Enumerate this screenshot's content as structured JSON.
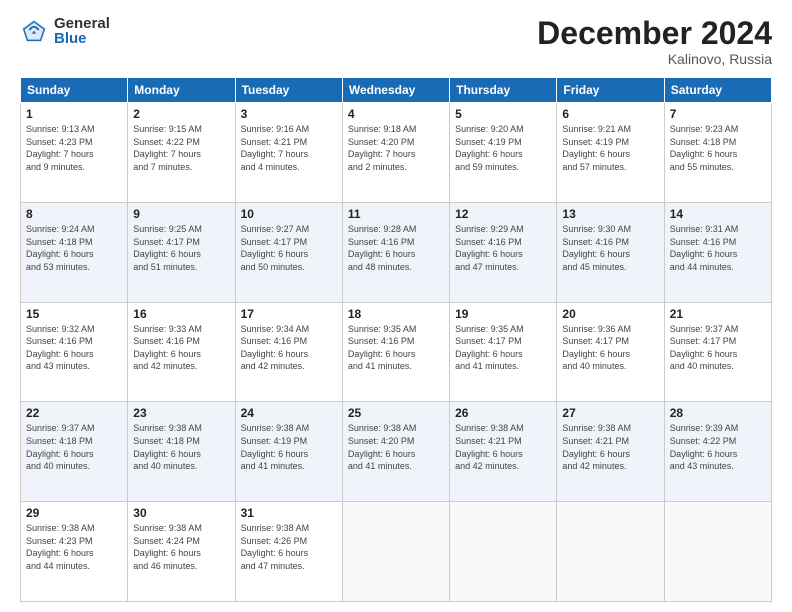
{
  "logo": {
    "general": "General",
    "blue": "Blue"
  },
  "title": "December 2024",
  "location": "Kalinovo, Russia",
  "days_of_week": [
    "Sunday",
    "Monday",
    "Tuesday",
    "Wednesday",
    "Thursday",
    "Friday",
    "Saturday"
  ],
  "weeks": [
    [
      {
        "day": 1,
        "info": "Sunrise: 9:13 AM\nSunset: 4:23 PM\nDaylight: 7 hours\nand 9 minutes."
      },
      {
        "day": 2,
        "info": "Sunrise: 9:15 AM\nSunset: 4:22 PM\nDaylight: 7 hours\nand 7 minutes."
      },
      {
        "day": 3,
        "info": "Sunrise: 9:16 AM\nSunset: 4:21 PM\nDaylight: 7 hours\nand 4 minutes."
      },
      {
        "day": 4,
        "info": "Sunrise: 9:18 AM\nSunset: 4:20 PM\nDaylight: 7 hours\nand 2 minutes."
      },
      {
        "day": 5,
        "info": "Sunrise: 9:20 AM\nSunset: 4:19 PM\nDaylight: 6 hours\nand 59 minutes."
      },
      {
        "day": 6,
        "info": "Sunrise: 9:21 AM\nSunset: 4:19 PM\nDaylight: 6 hours\nand 57 minutes."
      },
      {
        "day": 7,
        "info": "Sunrise: 9:23 AM\nSunset: 4:18 PM\nDaylight: 6 hours\nand 55 minutes."
      }
    ],
    [
      {
        "day": 8,
        "info": "Sunrise: 9:24 AM\nSunset: 4:18 PM\nDaylight: 6 hours\nand 53 minutes."
      },
      {
        "day": 9,
        "info": "Sunrise: 9:25 AM\nSunset: 4:17 PM\nDaylight: 6 hours\nand 51 minutes."
      },
      {
        "day": 10,
        "info": "Sunrise: 9:27 AM\nSunset: 4:17 PM\nDaylight: 6 hours\nand 50 minutes."
      },
      {
        "day": 11,
        "info": "Sunrise: 9:28 AM\nSunset: 4:16 PM\nDaylight: 6 hours\nand 48 minutes."
      },
      {
        "day": 12,
        "info": "Sunrise: 9:29 AM\nSunset: 4:16 PM\nDaylight: 6 hours\nand 47 minutes."
      },
      {
        "day": 13,
        "info": "Sunrise: 9:30 AM\nSunset: 4:16 PM\nDaylight: 6 hours\nand 45 minutes."
      },
      {
        "day": 14,
        "info": "Sunrise: 9:31 AM\nSunset: 4:16 PM\nDaylight: 6 hours\nand 44 minutes."
      }
    ],
    [
      {
        "day": 15,
        "info": "Sunrise: 9:32 AM\nSunset: 4:16 PM\nDaylight: 6 hours\nand 43 minutes."
      },
      {
        "day": 16,
        "info": "Sunrise: 9:33 AM\nSunset: 4:16 PM\nDaylight: 6 hours\nand 42 minutes."
      },
      {
        "day": 17,
        "info": "Sunrise: 9:34 AM\nSunset: 4:16 PM\nDaylight: 6 hours\nand 42 minutes."
      },
      {
        "day": 18,
        "info": "Sunrise: 9:35 AM\nSunset: 4:16 PM\nDaylight: 6 hours\nand 41 minutes."
      },
      {
        "day": 19,
        "info": "Sunrise: 9:35 AM\nSunset: 4:17 PM\nDaylight: 6 hours\nand 41 minutes."
      },
      {
        "day": 20,
        "info": "Sunrise: 9:36 AM\nSunset: 4:17 PM\nDaylight: 6 hours\nand 40 minutes."
      },
      {
        "day": 21,
        "info": "Sunrise: 9:37 AM\nSunset: 4:17 PM\nDaylight: 6 hours\nand 40 minutes."
      }
    ],
    [
      {
        "day": 22,
        "info": "Sunrise: 9:37 AM\nSunset: 4:18 PM\nDaylight: 6 hours\nand 40 minutes."
      },
      {
        "day": 23,
        "info": "Sunrise: 9:38 AM\nSunset: 4:18 PM\nDaylight: 6 hours\nand 40 minutes."
      },
      {
        "day": 24,
        "info": "Sunrise: 9:38 AM\nSunset: 4:19 PM\nDaylight: 6 hours\nand 41 minutes."
      },
      {
        "day": 25,
        "info": "Sunrise: 9:38 AM\nSunset: 4:20 PM\nDaylight: 6 hours\nand 41 minutes."
      },
      {
        "day": 26,
        "info": "Sunrise: 9:38 AM\nSunset: 4:21 PM\nDaylight: 6 hours\nand 42 minutes."
      },
      {
        "day": 27,
        "info": "Sunrise: 9:38 AM\nSunset: 4:21 PM\nDaylight: 6 hours\nand 42 minutes."
      },
      {
        "day": 28,
        "info": "Sunrise: 9:39 AM\nSunset: 4:22 PM\nDaylight: 6 hours\nand 43 minutes."
      }
    ],
    [
      {
        "day": 29,
        "info": "Sunrise: 9:38 AM\nSunset: 4:23 PM\nDaylight: 6 hours\nand 44 minutes."
      },
      {
        "day": 30,
        "info": "Sunrise: 9:38 AM\nSunset: 4:24 PM\nDaylight: 6 hours\nand 46 minutes."
      },
      {
        "day": 31,
        "info": "Sunrise: 9:38 AM\nSunset: 4:26 PM\nDaylight: 6 hours\nand 47 minutes."
      },
      null,
      null,
      null,
      null
    ]
  ]
}
